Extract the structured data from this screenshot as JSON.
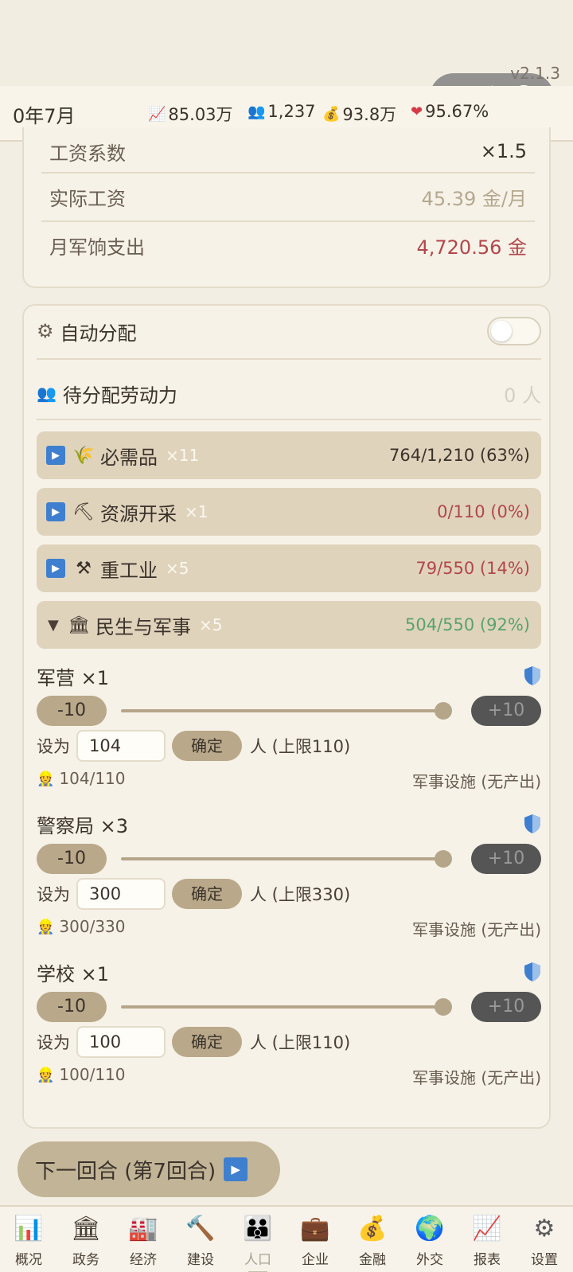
{
  "app": {
    "version": "v2.1.3"
  },
  "capsule": {
    "more_icon": "ellipsis-icon",
    "close_icon": "target-icon"
  },
  "header": {
    "date": "0年7月",
    "stats": [
      {
        "icon": "chart-up-icon",
        "glyph": "📈",
        "value": "85.03万"
      },
      {
        "icon": "people-icon",
        "glyph": "👥",
        "value": "1,237"
      },
      {
        "icon": "money-bag-icon",
        "glyph": "💰",
        "value": "93.8万"
      },
      {
        "icon": "heart-icon",
        "glyph": "❤",
        "value": "95.67%"
      }
    ]
  },
  "wage_card": {
    "rows": [
      {
        "label": "工资系数",
        "value": "×1.5",
        "color": "#3b332b"
      },
      {
        "label": "实际工资",
        "value": "45.39 金/月",
        "color": "#b5a88f"
      },
      {
        "label": "月军饷支出",
        "value": "4,720.56 金",
        "color": "#b2474a"
      }
    ]
  },
  "allocation": {
    "auto_label": "自动分配",
    "auto_enabled": false,
    "pending_label": "待分配劳动力",
    "pending_value": "0 人",
    "categories": [
      {
        "expanded": false,
        "icon": "wheat-icon",
        "glyph": "🌾",
        "name": "必需品",
        "mult": "×11",
        "value": "764/1,210 (63%)",
        "color": "#3b332b"
      },
      {
        "expanded": false,
        "icon": "pickaxe-icon",
        "glyph": "⛏",
        "name": "资源开采",
        "mult": "×1",
        "value": "0/110 (0%)",
        "color": "#b2474a"
      },
      {
        "expanded": false,
        "icon": "hammers-icon",
        "glyph": "⚒",
        "name": "重工业",
        "mult": "×5",
        "value": "79/550 (14%)",
        "color": "#b2474a"
      },
      {
        "expanded": true,
        "toggle_glyph": "▼",
        "icon": "classical-building-icon",
        "glyph": "🏛",
        "name": "民生与军事",
        "mult": "×5",
        "value": "504/550 (92%)",
        "color": "#58a36e"
      }
    ],
    "facilities": [
      {
        "title": "军营 ×1",
        "minus": "-10",
        "plus": "+10",
        "fill": 1.0,
        "set_label": "设为",
        "input": "104",
        "confirm": "确定",
        "unit": "人 (上限110)",
        "workers": "104/110",
        "info": "军事设施 (无产出)"
      },
      {
        "title": "警察局 ×3",
        "minus": "-10",
        "plus": "+10",
        "fill": 1.0,
        "set_label": "设为",
        "input": "300",
        "confirm": "确定",
        "unit": "人 (上限330)",
        "workers": "300/330",
        "info": "军事设施 (无产出)"
      },
      {
        "title": "学校 ×1",
        "minus": "-10",
        "plus": "+10",
        "fill": 1.0,
        "set_label": "设为",
        "input": "100",
        "confirm": "确定",
        "unit": "人 (上限110)",
        "workers": "100/110",
        "info": "军事设施 (无产出)"
      }
    ]
  },
  "next_turn": {
    "label": "下一回合 (第7回合)"
  },
  "tabs": [
    {
      "label": "概况",
      "icon": "bar-chart-icon",
      "glyph": "📊",
      "active": false
    },
    {
      "label": "政务",
      "icon": "classical-building-icon",
      "glyph": "🏛",
      "active": false
    },
    {
      "label": "经济",
      "icon": "factory-icon",
      "glyph": "🏭",
      "active": false
    },
    {
      "label": "建设",
      "icon": "hammer-icon",
      "glyph": "🔨",
      "active": false
    },
    {
      "label": "人口",
      "icon": "family-icon",
      "glyph": "👪",
      "active": true
    },
    {
      "label": "企业",
      "icon": "briefcase-icon",
      "glyph": "💼",
      "active": false
    },
    {
      "label": "金融",
      "icon": "money-bag-icon",
      "glyph": "💰",
      "active": false
    },
    {
      "label": "外交",
      "icon": "globe-icon",
      "glyph": "🌍",
      "active": false
    },
    {
      "label": "报表",
      "icon": "chart-up-icon",
      "glyph": "📈",
      "active": false
    },
    {
      "label": "设置",
      "icon": "gear-icon",
      "glyph": "⚙",
      "active": false
    }
  ]
}
